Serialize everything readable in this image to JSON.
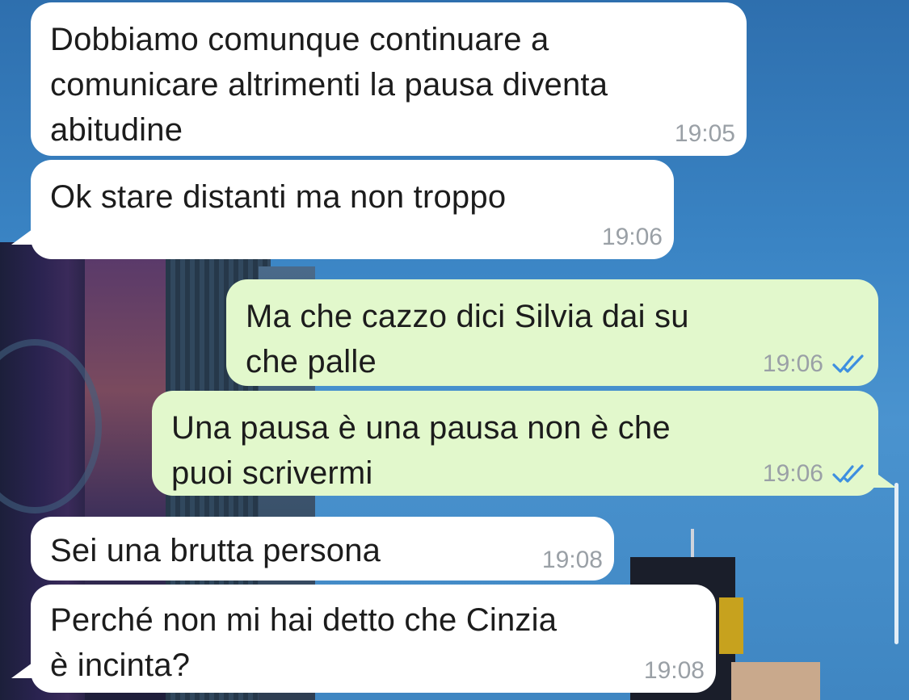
{
  "chat": {
    "messages": [
      {
        "direction": "incoming",
        "text": "Dobbiamo comunque continuare a\ncomunicare altrimenti la pausa diventa\nabitudine",
        "time": "19:05"
      },
      {
        "direction": "incoming",
        "text": "Ok stare distanti ma non troppo",
        "time": "19:06"
      },
      {
        "direction": "outgoing",
        "text": "Ma che cazzo dici Silvia dai su\nche palle",
        "time": "19:06",
        "status": "read"
      },
      {
        "direction": "outgoing",
        "text": "Una pausa è una pausa non è che\npuoi scrivermi",
        "time": "19:06",
        "status": "read"
      },
      {
        "direction": "incoming",
        "text": "Sei una brutta persona",
        "time": "19:08"
      },
      {
        "direction": "incoming",
        "text": "Perché non mi hai detto che Cinzia\nè incinta?",
        "time": "19:08"
      }
    ]
  },
  "colors": {
    "incoming_bubble": "#ffffff",
    "outgoing_bubble": "#e2f8cc",
    "timestamp": "#9aa0a6",
    "read_ticks": "#3d8fe0"
  },
  "icons": {
    "read_receipt": "double-check-icon"
  }
}
